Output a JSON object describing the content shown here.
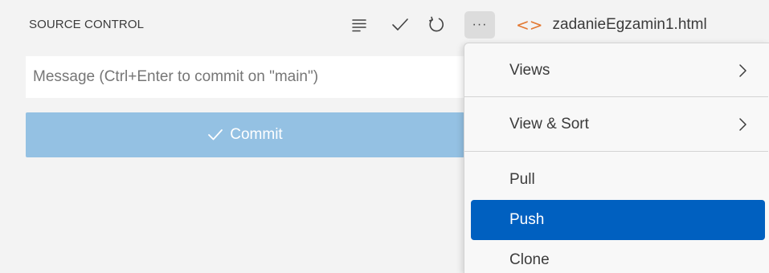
{
  "panel": {
    "title": "SOURCE CONTROL",
    "toolbar": {
      "view_list_icon": "list-flat-icon",
      "commit_icon": "check-icon",
      "refresh_icon": "refresh-icon",
      "more_icon": "ellipsis-icon",
      "more_label": "···"
    },
    "message_placeholder": "Message (Ctrl+Enter to commit on \"main\")",
    "commit_label": "Commit"
  },
  "tab": {
    "icon": "code-file-icon",
    "icon_glyph": "<>",
    "label": "zadanieEgzamin1.html"
  },
  "menu": {
    "items": [
      {
        "label": "Views",
        "submenu": true
      },
      {
        "label": "View & Sort",
        "submenu": true
      },
      {
        "label": "Pull",
        "submenu": false
      },
      {
        "label": "Push",
        "submenu": false,
        "selected": true
      },
      {
        "label": "Clone",
        "submenu": false
      }
    ]
  },
  "colors": {
    "accent": "#0060c0",
    "commit_button": "#94c1e3",
    "file_icon": "#e37933"
  }
}
